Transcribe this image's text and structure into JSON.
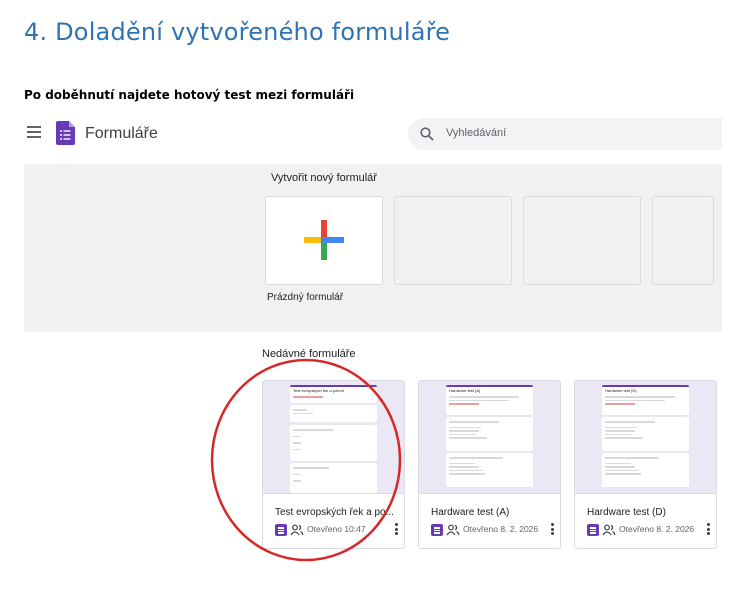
{
  "document": {
    "heading": "4. Doladění vytvořeného formuláře",
    "subheading": "Po doběhnutí najdete hotový test mezi formuláři"
  },
  "app": {
    "title": "Formuláře",
    "menu_icon": "hamburger-menu-icon",
    "logo_icon": "google-forms-icon"
  },
  "search": {
    "placeholder": "Vyhledávání",
    "icon": "search-icon"
  },
  "gallery": {
    "title": "Vytvořit nový formulář",
    "blank_label": "Prázdný formulář",
    "blank_icon": "multicolor-plus-icon"
  },
  "recent": {
    "title": "Nedávné formuláře",
    "items": [
      {
        "name": "Test evropských řek a po...",
        "opened": "Otevřeno 10:47",
        "preview_title": "Test evropských řek a pohoří"
      },
      {
        "name": "Hardware test (A)",
        "opened": "Otevřeno 8. 2. 2026",
        "preview_title": "Hardware test (A)"
      },
      {
        "name": "Hardware test (D)",
        "opened": "Otevřeno 8. 2. 2026",
        "preview_title": "Hardware test (D)"
      }
    ]
  },
  "colors": {
    "heading_blue": "#2e74b5",
    "forms_purple": "#673ab7",
    "annotation_red": "#d62828"
  }
}
